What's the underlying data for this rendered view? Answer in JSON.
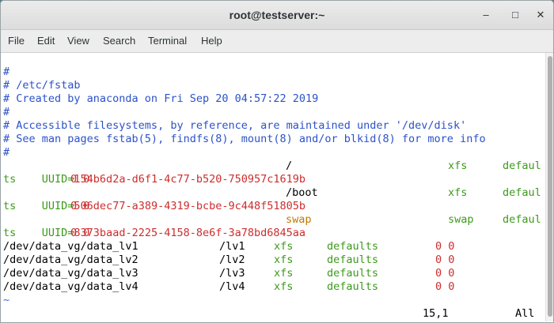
{
  "window": {
    "title": "root@testserver:~",
    "minimize_glyph": "–",
    "maximize_glyph": "□",
    "close_glyph": "✕"
  },
  "menu": [
    "File",
    "Edit",
    "View",
    "Search",
    "Terminal",
    "Help"
  ],
  "terminal": {
    "comments": [
      "#",
      "# /etc/fstab",
      "# Created by anaconda on Fri Sep 20 04:57:22 2019",
      "#",
      "# Accessible filesystems, by reference, are maintained under '/dev/disk'",
      "# See man pages fstab(5), findfs(8), mount(8) and/or blkid(8) for more info",
      "#"
    ],
    "uuid_entries": [
      {
        "key": "UUID=",
        "uuid": "154b6d2a-d6f1-4c77-b520-750957c1619b",
        "mount": "/",
        "fs": "xfs",
        "opts_head": "defaul",
        "opts_tail": "ts",
        "dump_pass": "0 0"
      },
      {
        "key": "UUID=",
        "uuid": "506dec77-a389-4319-bcbe-9c448f51805b",
        "mount": "/boot",
        "fs": "xfs",
        "opts_head": "defaul",
        "opts_tail": "ts",
        "dump_pass": "0 0"
      },
      {
        "key": "UUID=",
        "uuid": "8373baad-2225-4158-8e6f-3a78bd6845aa",
        "mount": "swap",
        "fs": "swap",
        "opts_head": "defaul",
        "opts_tail": "ts",
        "dump_pass": "0 0"
      }
    ],
    "lv_entries": [
      {
        "device": "/dev/data_vg/data_lv1",
        "mount": "/lv1",
        "fs": "xfs",
        "opts": "defaults",
        "dump_pass": "0 0"
      },
      {
        "device": "/dev/data_vg/data_lv2",
        "mount": "/lv2",
        "fs": "xfs",
        "opts": "defaults",
        "dump_pass": "0 0"
      },
      {
        "device": "/dev/data_vg/data_lv3",
        "mount": "/lv3",
        "fs": "xfs",
        "opts": "defaults",
        "dump_pass": "0 0"
      },
      {
        "device": "/dev/data_vg/data_lv4",
        "mount": "/lv4",
        "fs": "xfs",
        "opts": "defaults",
        "dump_pass": "0 0"
      }
    ],
    "tilde": "~",
    "status": {
      "position": "15,1",
      "scope": "All"
    }
  },
  "colors": {
    "comment": "#2b52c9",
    "uuid": "#cd2d2d",
    "keyword": "#3c9a1a",
    "swap": "#c07a00"
  }
}
